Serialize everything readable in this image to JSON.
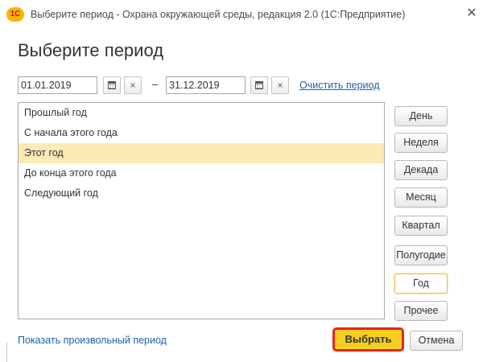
{
  "window": {
    "logo_text": "1С",
    "title": "Выберите период - Охрана окружающей среды, редакция 2.0  (1С:Предприятие)",
    "close_glyph": "✕"
  },
  "dialog": {
    "heading": "Выберите период"
  },
  "range": {
    "start_date": "01.01.2019",
    "end_date": "31.12.2019",
    "separator": "–",
    "clear_glyph": "×",
    "clear_link": "Очистить период"
  },
  "periods": {
    "items": [
      {
        "label": "Прошлый год"
      },
      {
        "label": "С начала этого года"
      },
      {
        "label": "Этот год",
        "selected": true
      },
      {
        "label": "До конца этого года"
      },
      {
        "label": "Следующий год"
      }
    ]
  },
  "granularity": {
    "buttons": [
      {
        "label": "День"
      },
      {
        "label": "Неделя"
      },
      {
        "label": "Декада"
      },
      {
        "label": "Месяц"
      },
      {
        "label": "Квартал"
      },
      {
        "label": "Полугодие"
      },
      {
        "label": "Год",
        "active": true
      },
      {
        "label": "Прочее"
      }
    ]
  },
  "footer": {
    "show_link": "Показать произвольный период",
    "select_button": "Выбрать",
    "cancel_button": "Отмена"
  },
  "colors": {
    "accent_link": "#1f5fb0",
    "selected_row": "#fbeab6",
    "primary_button": "#f5cf1f",
    "primary_outline": "#e3261c"
  }
}
